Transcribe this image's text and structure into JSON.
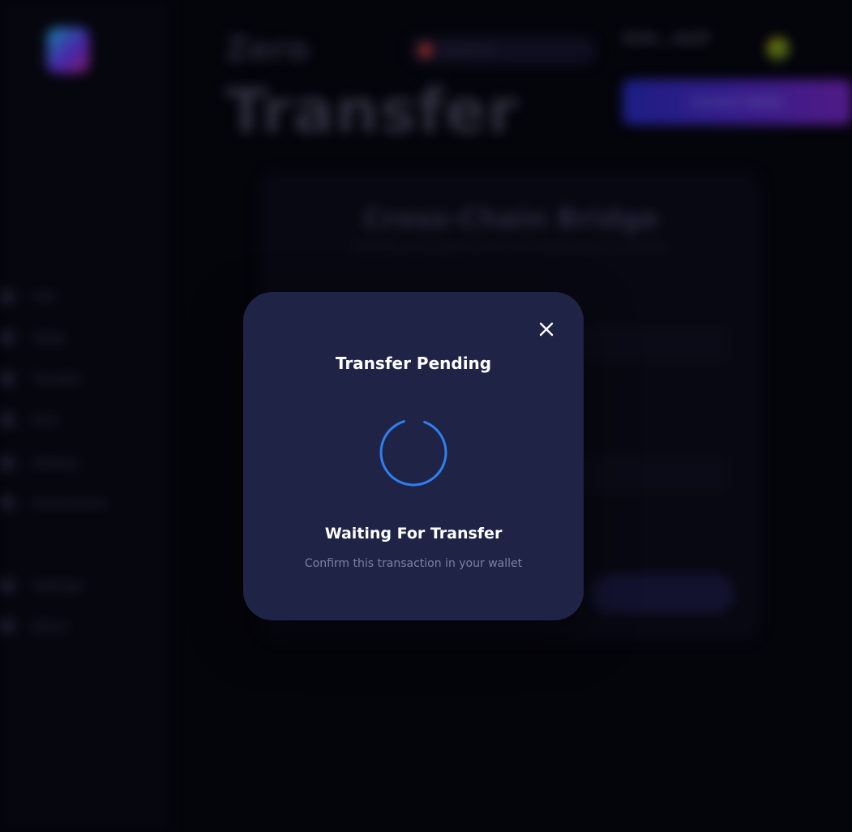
{
  "background": {
    "sidebar": {
      "items": [
        {
          "label": "Info",
          "icon": "info-icon"
        },
        {
          "label": "Swap",
          "icon": "swap-icon"
        },
        {
          "label": "Transfer",
          "icon": "transfer-icon"
        },
        {
          "label": "Pool",
          "icon": "pool-icon"
        },
        {
          "label": "Staking",
          "icon": "staking-icon"
        },
        {
          "label": "Governance",
          "icon": "governance-icon"
        },
        {
          "label": "Settings",
          "icon": "settings-icon"
        },
        {
          "label": "About",
          "icon": "about-icon"
        }
      ]
    },
    "header": {
      "title_small": "Zero",
      "title_big": "Transfer",
      "network_label": "Ethereum",
      "wallet_address": "0x9c...4a2f",
      "connect_label": "Connect Wallet"
    },
    "bridge": {
      "title": "Cross-Chain Bridge",
      "subtitle": "Transfer your tokens from one blockchain to another"
    }
  },
  "modal": {
    "title": "Transfer Pending",
    "status_title": "Waiting For Transfer",
    "status_subtitle": "Confirm this transaction in your wallet",
    "close_icon": "close-icon",
    "spinner_icon": "spinner-icon",
    "colors": {
      "modal_bg": "#1f2447",
      "spinner": "#2f7ff0",
      "subtitle": "#7c80a4"
    }
  }
}
